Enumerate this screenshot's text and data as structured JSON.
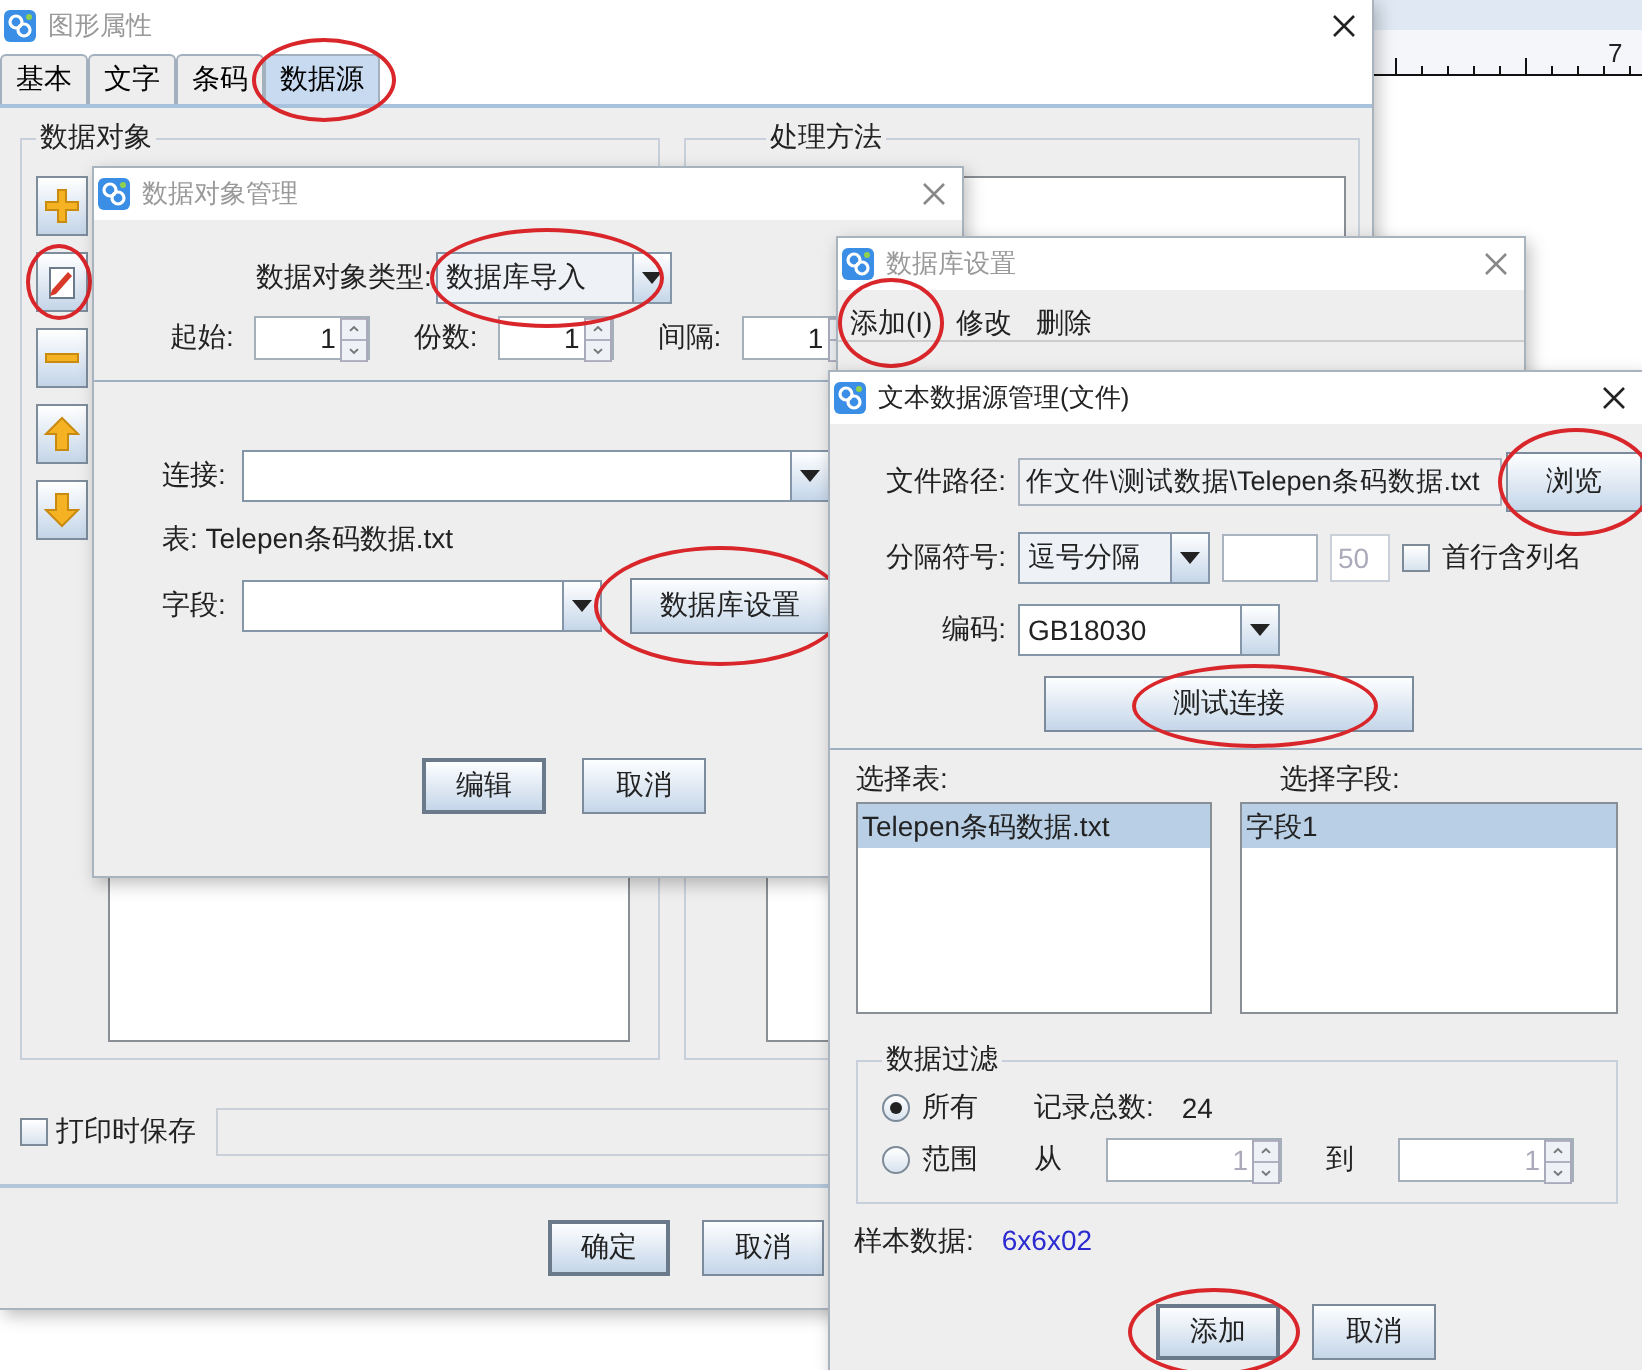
{
  "canvas": {
    "ruler_label": "7"
  },
  "properties_window": {
    "title": "图形属性",
    "tabs": [
      {
        "label": "基本",
        "selected": false,
        "circled": false
      },
      {
        "label": "文字",
        "selected": false,
        "circled": false
      },
      {
        "label": "条码",
        "selected": false,
        "circled": false
      },
      {
        "label": "数据源",
        "selected": true,
        "circled": true
      }
    ],
    "data_objects_group": {
      "title": "数据对象",
      "tool_buttons": [
        {
          "kind": "add",
          "circled": false
        },
        {
          "kind": "edit",
          "circled": true
        },
        {
          "kind": "remove",
          "circled": false
        },
        {
          "kind": "up",
          "circled": false
        },
        {
          "kind": "down",
          "circled": false
        }
      ]
    },
    "processing_group": {
      "title": "处理方法"
    },
    "save_on_print": {
      "label": "打印时保存",
      "checked": false
    },
    "buttons": [
      {
        "label": "确定",
        "default": true
      },
      {
        "label": "取消",
        "default": false
      }
    ]
  },
  "data_object_dialog": {
    "title": "数据对象管理",
    "type_label": "数据对象类型:",
    "type_value": "数据库导入",
    "type_circled": true,
    "spinners": [
      {
        "label": "起始:",
        "value": "1"
      },
      {
        "label": "份数:",
        "value": "1"
      },
      {
        "label": "间隔:",
        "value": "1"
      }
    ],
    "connection_label": "连接:",
    "table_text": "表: Telepen条码数据.txt",
    "field_label": "字段:",
    "db_settings_button": {
      "label": "数据库设置",
      "circled": true
    },
    "buttons": [
      {
        "label": "编辑",
        "default": true
      },
      {
        "label": "取消",
        "default": false
      }
    ]
  },
  "db_settings_dialog": {
    "title": "数据库设置",
    "menu": [
      {
        "label": "添加(I)",
        "circled": true
      },
      {
        "label": "修改"
      },
      {
        "label": "删除"
      }
    ]
  },
  "text_source_dialog": {
    "title": "文本数据源管理(文件)",
    "path_label": "文件路径:",
    "path_value": "作文件\\测试数据\\Telepen条码数据.txt",
    "browse_button": {
      "label": "浏览",
      "circled": true
    },
    "delimiter_label": "分隔符号:",
    "delimiter_value": "逗号分隔",
    "delimiter_fields": [
      {
        "disabled": false
      },
      {
        "value": "50",
        "disabled": true
      }
    ],
    "header_checkbox": {
      "label": "首行含列名",
      "checked": false
    },
    "encoding_label": "编码:",
    "encoding_value": "GB18030",
    "test_button": {
      "label": "测试连接",
      "circled": true
    },
    "table_list": {
      "label": "选择表:",
      "items": [
        {
          "label": "Telepen条码数据.txt",
          "selected": true
        }
      ]
    },
    "field_list": {
      "label": "选择字段:",
      "items": [
        {
          "label": "字段1",
          "selected": true
        }
      ]
    },
    "filter": {
      "title": "数据过滤",
      "options": [
        {
          "label": "所有",
          "selected": true
        },
        {
          "label": "范围",
          "selected": false
        }
      ],
      "count_label": "记录总数:",
      "count_value": "24",
      "from_label": "从",
      "to_label": "到",
      "range_spinners": [
        {
          "value": "1",
          "disabled": true
        },
        {
          "value": "1",
          "disabled": true
        }
      ]
    },
    "sample_label": "样本数据:",
    "sample_value": "6x6x02",
    "buttons": [
      {
        "label": "添加",
        "default": true,
        "circled": true
      },
      {
        "label": "取消",
        "default": false,
        "circled": false
      }
    ]
  }
}
